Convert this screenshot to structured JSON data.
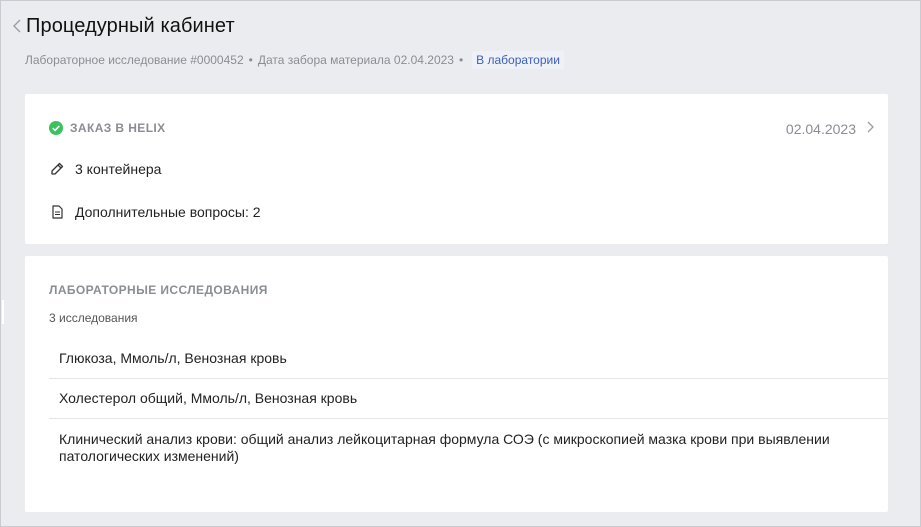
{
  "header": {
    "title": "Процедурный кабинет",
    "study_label": "Лабораторное исследование #0000452",
    "collection_date_label": "Дата забора материала 02.04.2023",
    "separator": "•",
    "status_badge": "В лаборатории"
  },
  "order": {
    "title": "ЗАКАЗ В HELIX",
    "date": "02.04.2023",
    "containers": "3 контейнера",
    "questions": "Дополнительные вопросы: 2",
    "status_color": "#3bc25f"
  },
  "lab": {
    "heading": "ЛАБОРАТОРНЫЕ ИССЛЕДОВАНИЯ",
    "count": "3 исследования",
    "items": [
      "Глюкоза, Ммоль/л, Венозная кровь",
      "Холестерол общий, Ммоль/л, Венозная кровь",
      "Клинический анализ крови: общий анализ лейкоцитарная формула СОЭ (с микроскопией мазка крови при выявлении патологических изменений)"
    ]
  },
  "icons": {
    "back": "chevron-left-icon",
    "check": "check-circle-icon",
    "chevron": "chevron-right-icon",
    "pipette": "pipette-icon",
    "document": "document-icon"
  }
}
